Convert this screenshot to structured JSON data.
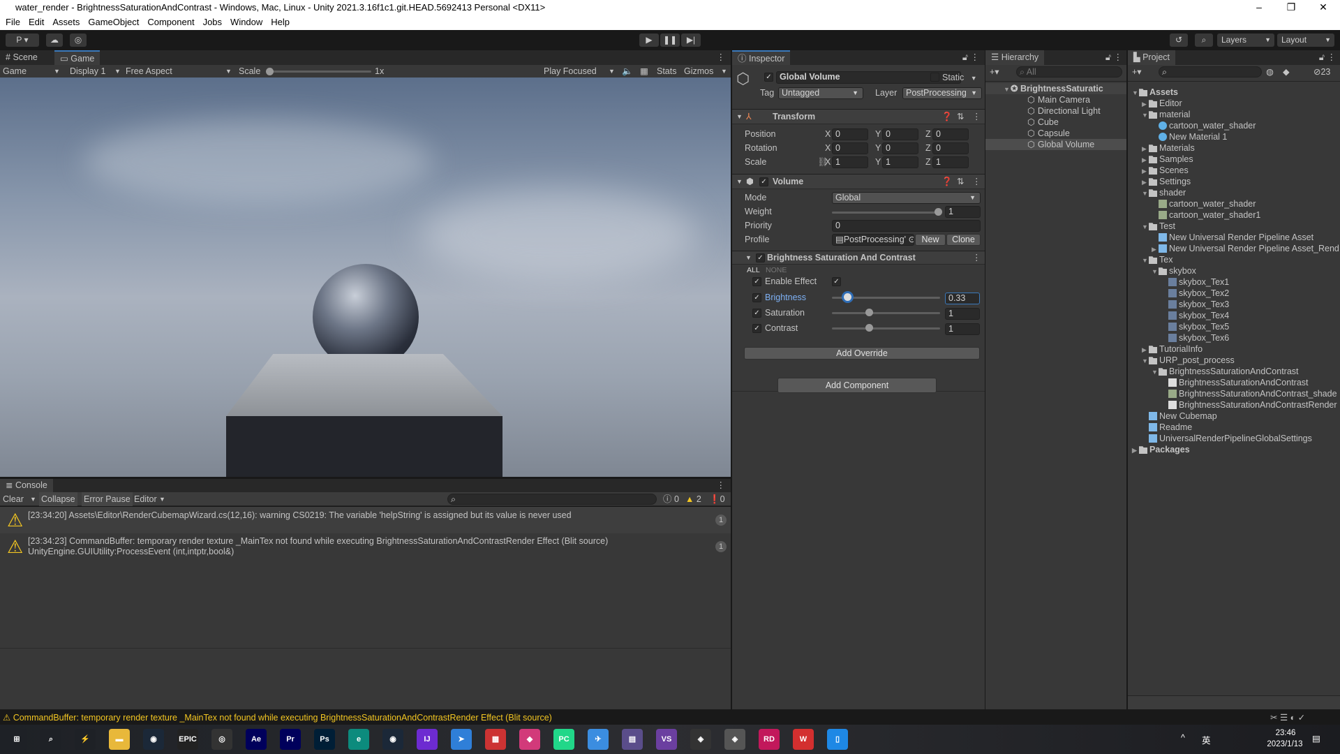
{
  "window": {
    "title": "water_render - BrightnessSaturationAndContrast - Windows, Mac, Linux - Unity 2021.3.16f1c1.git.HEAD.5692413 Personal <DX11>",
    "minimize": "–",
    "maximize": "❐",
    "close": "✕"
  },
  "menu": [
    "File",
    "Edit",
    "Assets",
    "GameObject",
    "Component",
    "Jobs",
    "Window",
    "Help"
  ],
  "toolbar": {
    "account": "P ▾",
    "layers": "Layers",
    "layout": "Layout"
  },
  "game": {
    "tabs": [
      "Scene",
      "Game"
    ],
    "mode": "Game",
    "display": "Display 1",
    "aspect": "Free Aspect",
    "scale_label": "Scale",
    "scale_value": "1x",
    "play_focused": "Play Focused",
    "stats": "Stats",
    "gizmos": "Gizmos"
  },
  "console": {
    "tab": "Console",
    "clear": "Clear",
    "collapse": "Collapse",
    "error_pause": "Error Pause",
    "editor": "Editor",
    "counts": {
      "info": "0",
      "warn": "2",
      "error": "0"
    },
    "messages": [
      {
        "line1": "[23:34:20] Assets\\Editor\\RenderCubemapWizard.cs(12,16): warning CS0219: The variable 'helpString' is assigned but its value is never used",
        "line2": "",
        "count": "1"
      },
      {
        "line1": "[23:34:23] CommandBuffer: temporary render texture _MainTex not found while executing BrightnessSaturationAndContrastRender Effect (Blit source)",
        "line2": "UnityEngine.GUIUtility:ProcessEvent (int,intptr,bool&)",
        "count": "1"
      }
    ]
  },
  "status_bar": "CommandBuffer: temporary render texture _MainTex not found while executing BrightnessSaturationAndContrastRender Effect (Blit source)",
  "inspector": {
    "tab": "Inspector",
    "object_name": "Global Volume",
    "static": "Static",
    "tag_label": "Tag",
    "tag": "Untagged",
    "layer_label": "Layer",
    "layer": "PostProcessing",
    "transform": {
      "title": "Transform",
      "rows": [
        {
          "label": "Position",
          "x": "0",
          "y": "0",
          "z": "0"
        },
        {
          "label": "Rotation",
          "x": "0",
          "y": "0",
          "z": "0"
        },
        {
          "label": "Scale",
          "x": "1",
          "y": "1",
          "z": "1"
        }
      ]
    },
    "volume": {
      "title": "Volume",
      "mode_label": "Mode",
      "mode": "Global",
      "weight_label": "Weight",
      "weight": "1",
      "priority_label": "Priority",
      "priority": "0",
      "profile_label": "Profile",
      "profile": "PostProcessing'",
      "new": "New",
      "clone": "Clone"
    },
    "effect": {
      "title": "Brightness Saturation And Contrast",
      "all": "ALL",
      "none": "NONE",
      "enable_label": "Enable Effect",
      "params": [
        {
          "label": "Brightness",
          "value": "0.33",
          "fraction": 0.14,
          "active": true
        },
        {
          "label": "Saturation",
          "value": "1",
          "fraction": 0.34,
          "active": false
        },
        {
          "label": "Contrast",
          "value": "1",
          "fraction": 0.34,
          "active": false
        }
      ]
    },
    "add_override": "Add Override",
    "add_component": "Add Component"
  },
  "hierarchy": {
    "tab": "Hierarchy",
    "search_placeholder": "All",
    "scene": "BrightnessSaturatic",
    "items": [
      "Main Camera",
      "Directional Light",
      "Cube",
      "Capsule",
      "Global Volume"
    ],
    "selected": "Global Volume"
  },
  "project": {
    "tab": "Project",
    "hidden_count": "23",
    "items": [
      {
        "l": 0,
        "a": "▼",
        "i": "folder",
        "t": "Assets",
        "b": true
      },
      {
        "l": 1,
        "a": "▶",
        "i": "folder",
        "t": "Editor"
      },
      {
        "l": 1,
        "a": "▼",
        "i": "folder",
        "t": "material"
      },
      {
        "l": 2,
        "a": "",
        "i": "material",
        "t": "cartoon_water_shader"
      },
      {
        "l": 2,
        "a": "",
        "i": "material",
        "t": "New Material 1"
      },
      {
        "l": 1,
        "a": "▶",
        "i": "folder",
        "t": "Materials"
      },
      {
        "l": 1,
        "a": "▶",
        "i": "folder",
        "t": "Samples"
      },
      {
        "l": 1,
        "a": "▶",
        "i": "folder",
        "t": "Scenes"
      },
      {
        "l": 1,
        "a": "▶",
        "i": "folder",
        "t": "Settings"
      },
      {
        "l": 1,
        "a": "▼",
        "i": "folder",
        "t": "shader"
      },
      {
        "l": 2,
        "a": "",
        "i": "shader",
        "t": "cartoon_water_shader"
      },
      {
        "l": 2,
        "a": "",
        "i": "shader",
        "t": "cartoon_water_shader1"
      },
      {
        "l": 1,
        "a": "▼",
        "i": "folder",
        "t": "Test"
      },
      {
        "l": 2,
        "a": "",
        "i": "asset",
        "t": "New Universal Render Pipeline Asset"
      },
      {
        "l": 2,
        "a": "▶",
        "i": "asset",
        "t": "New Universal Render Pipeline Asset_Rend"
      },
      {
        "l": 1,
        "a": "▼",
        "i": "folder",
        "t": "Tex"
      },
      {
        "l": 2,
        "a": "▼",
        "i": "folder",
        "t": "skybox"
      },
      {
        "l": 3,
        "a": "",
        "i": "texture",
        "t": "skybox_Tex1"
      },
      {
        "l": 3,
        "a": "",
        "i": "texture",
        "t": "skybox_Tex2"
      },
      {
        "l": 3,
        "a": "",
        "i": "texture",
        "t": "skybox_Tex3"
      },
      {
        "l": 3,
        "a": "",
        "i": "texture",
        "t": "skybox_Tex4"
      },
      {
        "l": 3,
        "a": "",
        "i": "texture",
        "t": "skybox_Tex5"
      },
      {
        "l": 3,
        "a": "",
        "i": "texture",
        "t": "skybox_Tex6"
      },
      {
        "l": 1,
        "a": "▶",
        "i": "folder",
        "t": "TutorialInfo"
      },
      {
        "l": 1,
        "a": "▼",
        "i": "folder",
        "t": "URP_post_process"
      },
      {
        "l": 2,
        "a": "▼",
        "i": "folder",
        "t": "BrightnessSaturationAndContrast"
      },
      {
        "l": 3,
        "a": "",
        "i": "script",
        "t": "BrightnessSaturationAndContrast"
      },
      {
        "l": 3,
        "a": "",
        "i": "shader",
        "t": "BrightnessSaturationAndContrast_shade"
      },
      {
        "l": 3,
        "a": "",
        "i": "script",
        "t": "BrightnessSaturationAndContrastRender"
      },
      {
        "l": 1,
        "a": "",
        "i": "asset",
        "t": "New Cubemap"
      },
      {
        "l": 1,
        "a": "",
        "i": "asset",
        "t": "Readme"
      },
      {
        "l": 1,
        "a": "",
        "i": "asset",
        "t": "UniversalRenderPipelineGlobalSettings"
      },
      {
        "l": 0,
        "a": "▶",
        "i": "folder",
        "t": "Packages",
        "b": true
      }
    ]
  },
  "taskbar": {
    "apps": [
      {
        "n": "start",
        "t": "⊞",
        "c": "#1e2126"
      },
      {
        "n": "search",
        "t": "⌕",
        "c": "#1e2126"
      },
      {
        "n": "app",
        "t": "⚡",
        "c": "#1e2126"
      },
      {
        "n": "file-explorer",
        "t": "▬",
        "c": "#e8b83a"
      },
      {
        "n": "steam",
        "t": "◉",
        "c": "#1b2838"
      },
      {
        "n": "epic",
        "t": "EPIC",
        "c": "#222"
      },
      {
        "n": "obs",
        "t": "◎",
        "c": "#333"
      },
      {
        "n": "after-effects",
        "t": "Ae",
        "c": "#00005b"
      },
      {
        "n": "premiere",
        "t": "Pr",
        "c": "#00005b"
      },
      {
        "n": "photoshop",
        "t": "Ps",
        "c": "#001e36"
      },
      {
        "n": "edge",
        "t": "e",
        "c": "#0c8b7d"
      },
      {
        "n": "steam2",
        "t": "◉",
        "c": "#1b2838"
      },
      {
        "n": "intellij",
        "t": "IJ",
        "c": "#6d2bd1"
      },
      {
        "n": "app2",
        "t": "➤",
        "c": "#2f7fd8"
      },
      {
        "n": "app3",
        "t": "▦",
        "c": "#c33"
      },
      {
        "n": "app4",
        "t": "◆",
        "c": "#d23a7a"
      },
      {
        "n": "pycharm",
        "t": "PC",
        "c": "#21d789"
      },
      {
        "n": "app5",
        "t": "✈",
        "c": "#3b8de0"
      },
      {
        "n": "app6",
        "t": "▤",
        "c": "#5a4d8a"
      },
      {
        "n": "visual-studio",
        "t": "VS",
        "c": "#6b3fa0"
      },
      {
        "n": "unity-hub",
        "t": "◈",
        "c": "#333"
      },
      {
        "n": "unity",
        "t": "◈",
        "c": "#555"
      },
      {
        "n": "rider",
        "t": "RD",
        "c": "#c2185b"
      },
      {
        "n": "wps",
        "t": "W",
        "c": "#d32f2f"
      },
      {
        "n": "app7",
        "t": "▯",
        "c": "#1e88e5"
      }
    ],
    "ime": "英",
    "clock_time": "23:46",
    "clock_date": "2023/1/13"
  }
}
